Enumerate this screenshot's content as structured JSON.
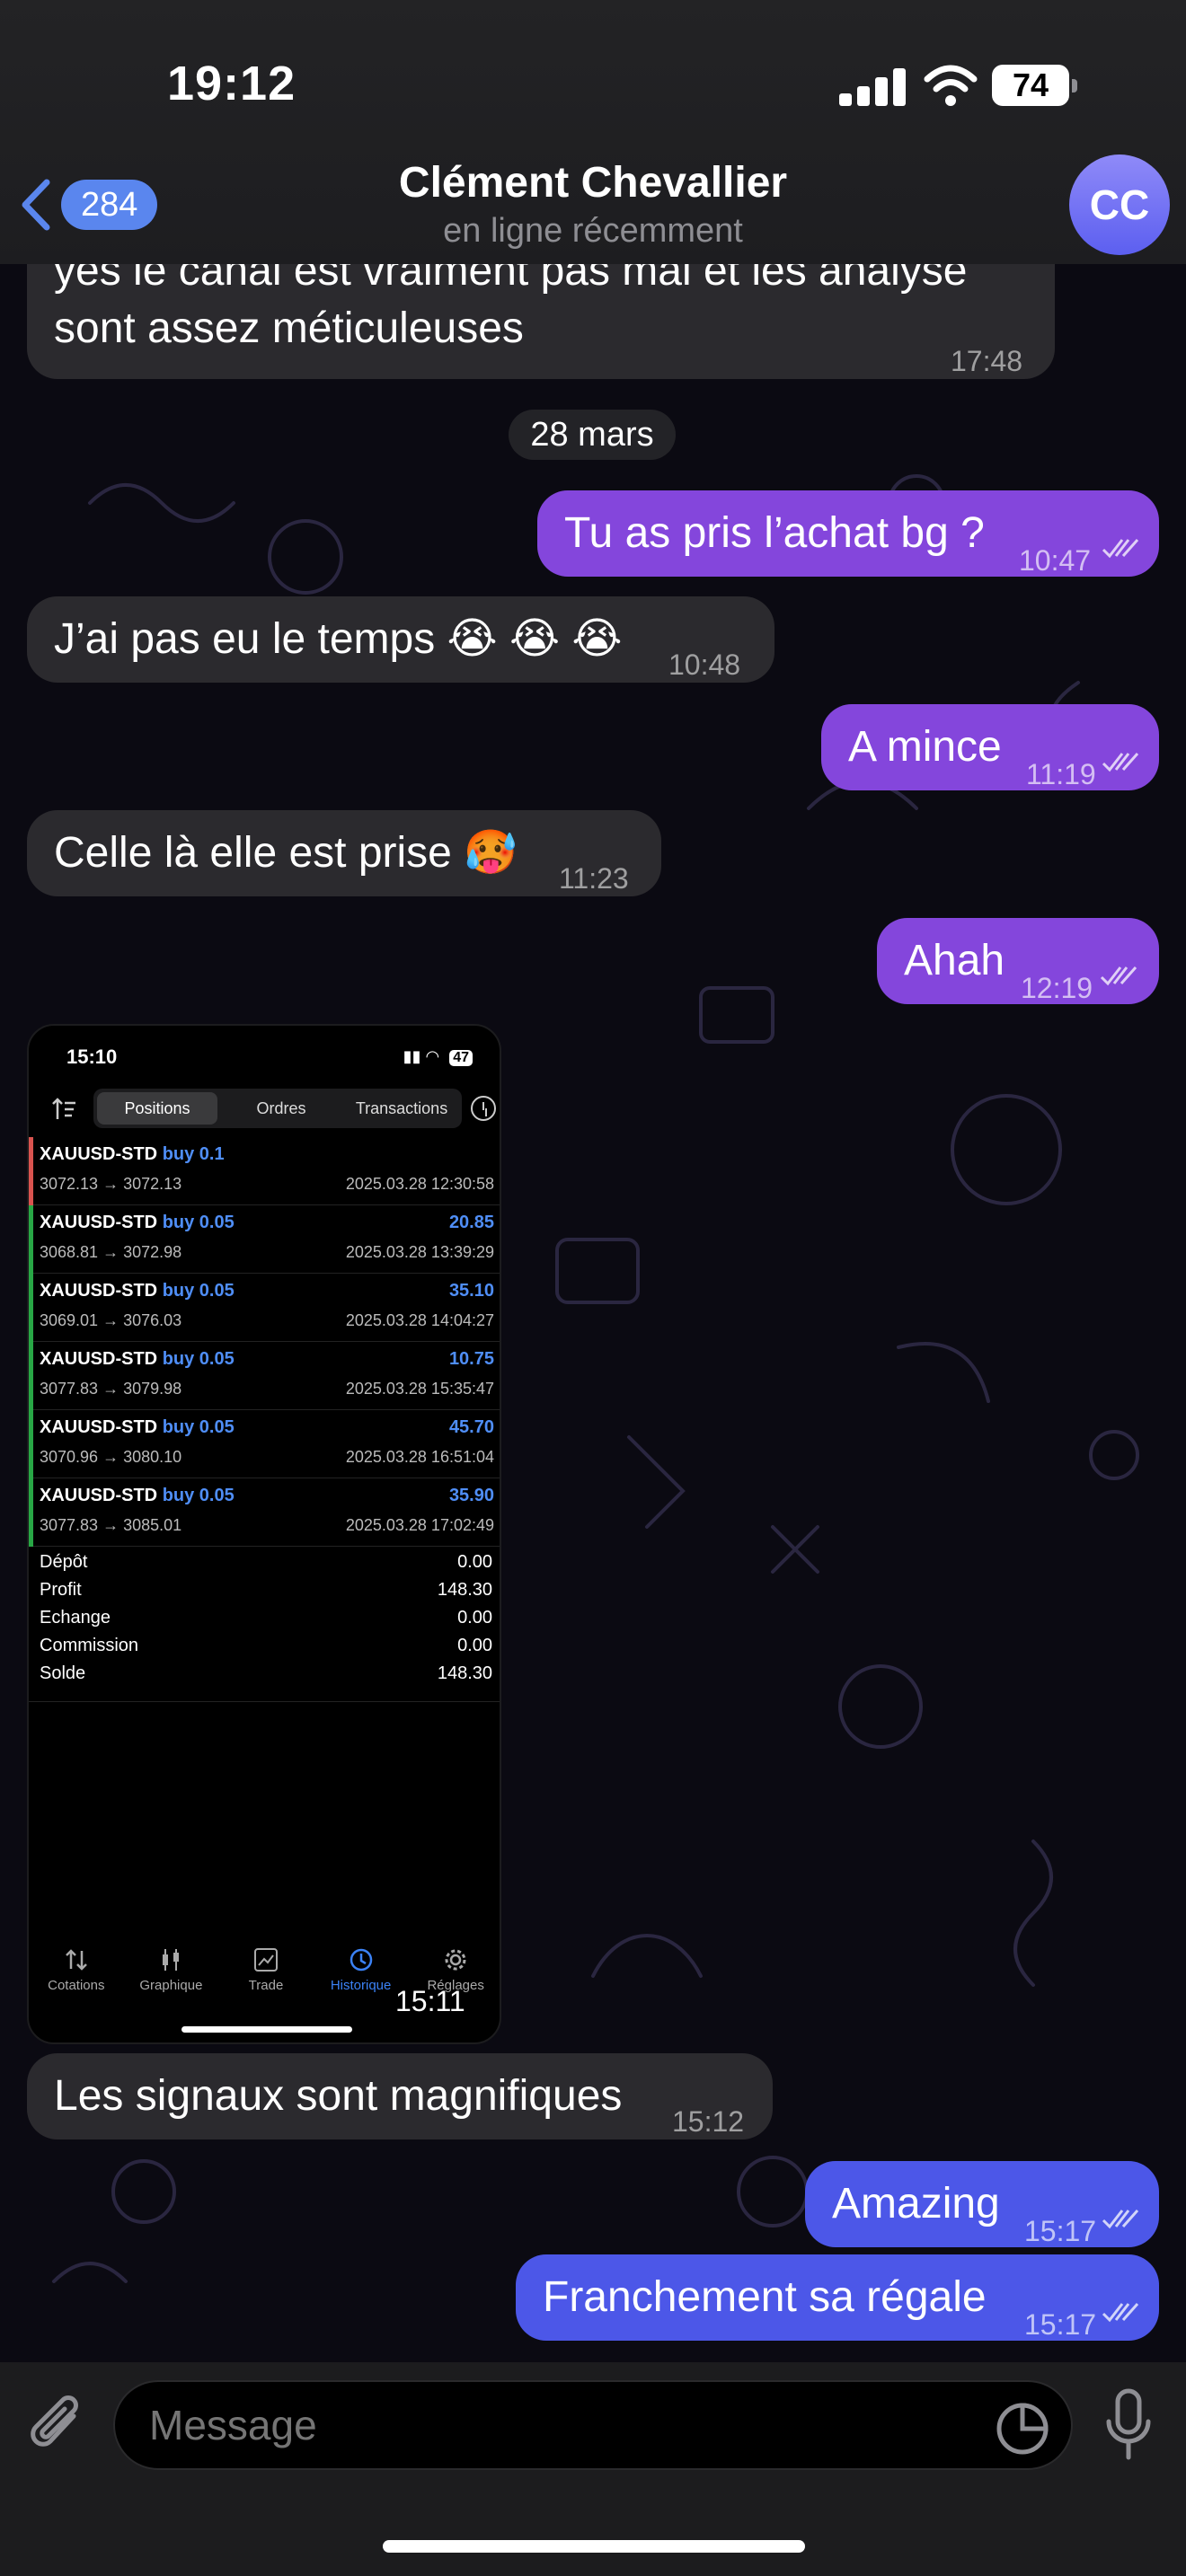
{
  "status_bar": {
    "time": "19:12",
    "battery": "74"
  },
  "header": {
    "back_count": "284",
    "title": "Clément Chevallier",
    "subtitle": "en ligne récemment",
    "avatar_initials": "CC"
  },
  "messages": {
    "m0": {
      "line1": "yes le canal est vraiment pas mal et les analyse",
      "line2": "sont assez méticuleuses",
      "time": "17:48"
    },
    "date_separator": "28 mars",
    "m1": {
      "text": "Tu as pris l’achat bg ?",
      "time": "10:47"
    },
    "m2": {
      "text": "J’ai pas eu le temps 😭 😭 😭",
      "time": "10:48"
    },
    "m3": {
      "text": "A mince",
      "time": "11:19"
    },
    "m4": {
      "text": "Celle là elle est prise 🥵",
      "time": "11:23"
    },
    "m5": {
      "text": "Ahah",
      "time": "12:19"
    },
    "m6": {
      "time": "15:11"
    },
    "m7": {
      "text": "Les signaux sont magnifiques",
      "time": "15:12"
    },
    "m8": {
      "text": "Amazing",
      "time": "15:17"
    },
    "m9": {
      "text": "Franchement sa régale",
      "time": "15:17"
    }
  },
  "embedded_screenshot": {
    "time": "15:10",
    "battery": "47",
    "tabs": [
      "Positions",
      "Ordres",
      "Transactions"
    ],
    "rows": [
      {
        "symbol": "XAUUSD-STD",
        "side": "buy 0.1",
        "range": "3072.13 → 3072.13",
        "pnl": "",
        "date": "2025.03.28 12:30:58"
      },
      {
        "symbol": "XAUUSD-STD",
        "side": "buy 0.05",
        "range": "3068.81 → 3072.98",
        "pnl": "20.85",
        "date": "2025.03.28 13:39:29"
      },
      {
        "symbol": "XAUUSD-STD",
        "side": "buy 0.05",
        "range": "3069.01 → 3076.03",
        "pnl": "35.10",
        "date": "2025.03.28 14:04:27"
      },
      {
        "symbol": "XAUUSD-STD",
        "side": "buy 0.05",
        "range": "3077.83 → 3079.98",
        "pnl": "10.75",
        "date": "2025.03.28 15:35:47"
      },
      {
        "symbol": "XAUUSD-STD",
        "side": "buy 0.05",
        "range": "3070.96 → 3080.10",
        "pnl": "45.70",
        "date": "2025.03.28 16:51:04"
      },
      {
        "symbol": "XAUUSD-STD",
        "side": "buy 0.05",
        "range": "3077.83 → 3085.01",
        "pnl": "35.90",
        "date": "2025.03.28 17:02:49"
      }
    ],
    "summary": [
      {
        "label": "Dépôt",
        "value": "0.00"
      },
      {
        "label": "Profit",
        "value": "148.30"
      },
      {
        "label": "Echange",
        "value": "0.00"
      },
      {
        "label": "Commission",
        "value": "0.00"
      },
      {
        "label": "Solde",
        "value": "148.30"
      }
    ],
    "nav": [
      "Cotations",
      "Graphique",
      "Trade",
      "Historique",
      "Réglages"
    ]
  },
  "input": {
    "placeholder": "Message"
  },
  "colors": {
    "outgoing_purple": "#8446dc",
    "outgoing_blue": "#4c57e8",
    "incoming": "#2b2a2e",
    "accent": "#5a86ee"
  }
}
